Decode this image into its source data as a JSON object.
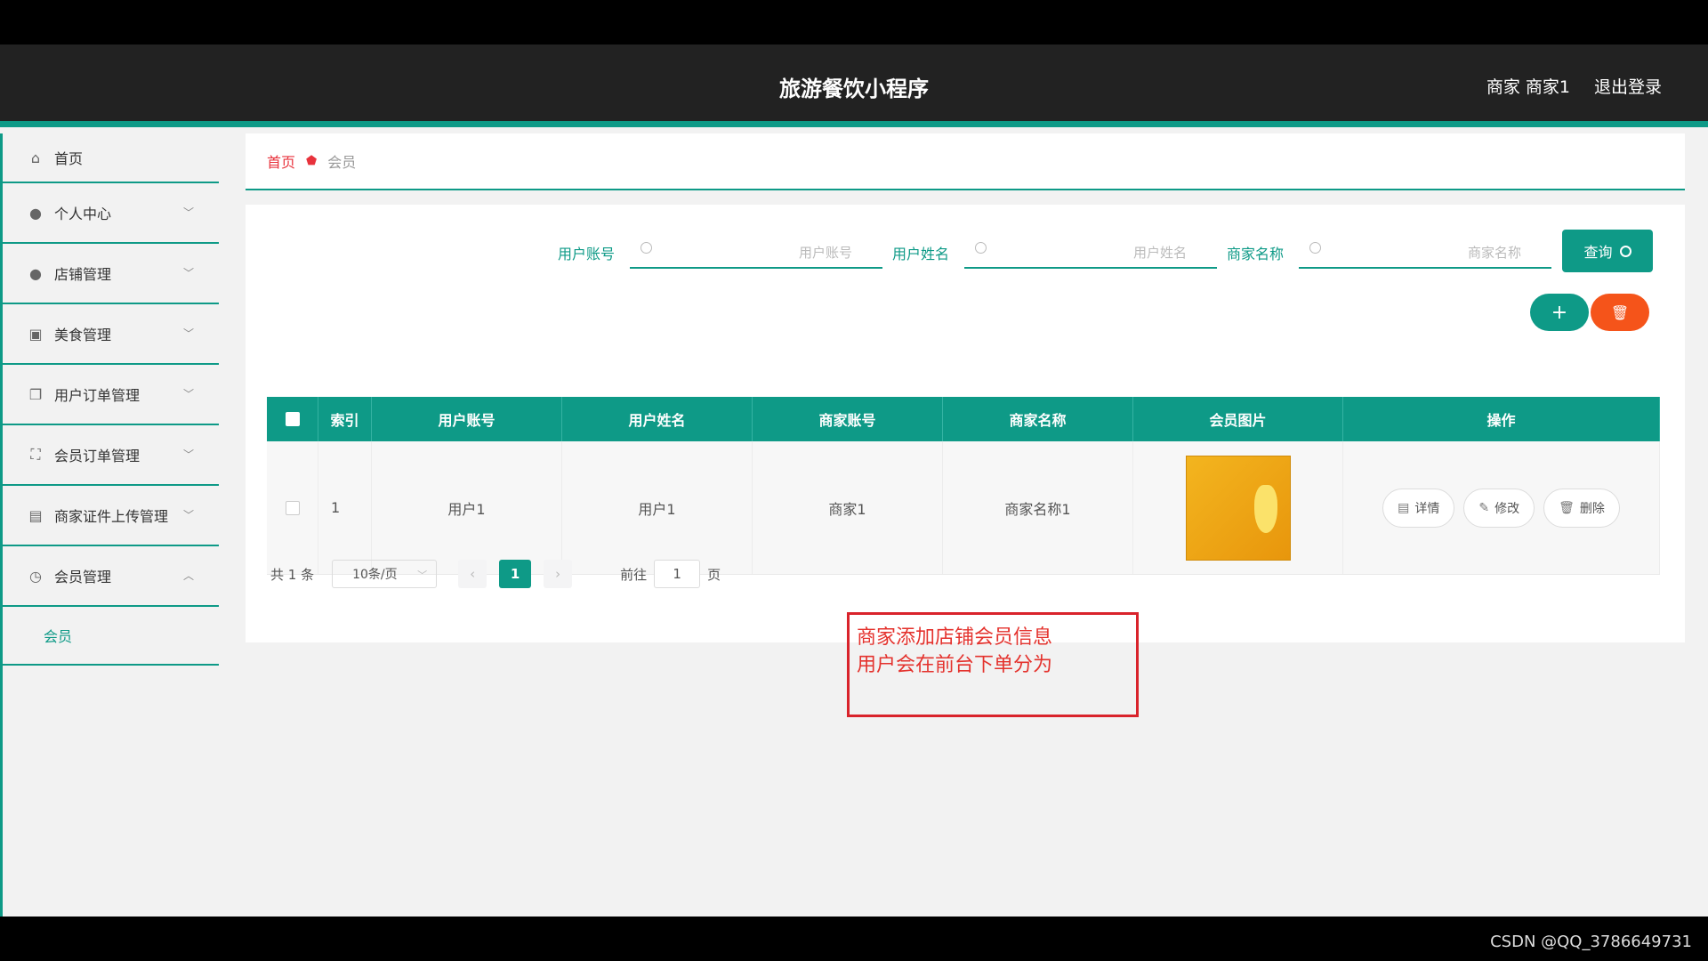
{
  "header": {
    "title": "旅游餐饮小程序",
    "user": "商家 商家1",
    "logout": "退出登录"
  },
  "sidebar": {
    "items": [
      {
        "label": "首页",
        "icon": "home-icon"
      },
      {
        "label": "个人中心",
        "icon": "user-icon"
      },
      {
        "label": "店铺管理",
        "icon": "user-icon"
      },
      {
        "label": "美食管理",
        "icon": "clipboard-icon"
      },
      {
        "label": "用户订单管理",
        "icon": "copy-icon"
      },
      {
        "label": "会员订单管理",
        "icon": "expand-icon"
      },
      {
        "label": "商家证件上传管理",
        "icon": "briefcase-icon"
      },
      {
        "label": "会员管理",
        "icon": "clock-icon"
      }
    ],
    "sub_item": "会员"
  },
  "breadcrumb": {
    "home": "首页",
    "current": "会员"
  },
  "search": {
    "fields": [
      {
        "label": "用户账号",
        "placeholder": "用户账号"
      },
      {
        "label": "用户姓名",
        "placeholder": "用户姓名"
      },
      {
        "label": "商家名称",
        "placeholder": "商家名称"
      }
    ],
    "query_label": "查询"
  },
  "table": {
    "headers": [
      "索引",
      "用户账号",
      "用户姓名",
      "商家账号",
      "商家名称",
      "会员图片",
      "操作"
    ],
    "rows": [
      {
        "index": "1",
        "account": "用户1",
        "name": "用户1",
        "merchant_account": "商家1",
        "merchant_name": "商家名称1"
      }
    ],
    "actions": {
      "detail": "详情",
      "edit": "修改",
      "delete": "删除"
    }
  },
  "pagination": {
    "total": "共 1 条",
    "page_size": "10条/页",
    "current_page": "1",
    "goto_label": "前往",
    "goto_value": "1",
    "page_suffix": "页"
  },
  "annotation": {
    "line1": "商家添加店铺会员信息",
    "line2": "用户会在前台下单分为"
  },
  "watermark": "CSDN @QQ_3786649731",
  "colors": {
    "accent": "#0e9a87",
    "danger": "#f5541a",
    "header_bg": "#222222",
    "annotation": "#d9232b"
  }
}
